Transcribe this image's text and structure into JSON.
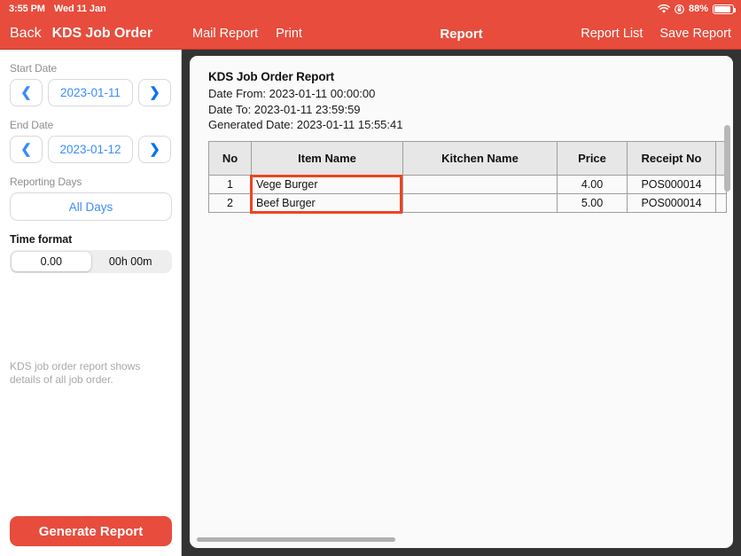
{
  "statusbar": {
    "time": "3:55 PM",
    "date": "Wed 11 Jan",
    "battery_percent": "88%",
    "wifi_icon": "wifi-icon",
    "rotation_lock_icon": "rotation-lock-icon",
    "battery_icon": "battery-icon"
  },
  "navbar": {
    "back_label": "Back",
    "screen_title": "KDS Job Order",
    "mail_report_label": "Mail Report",
    "print_label": "Print",
    "center_title": "Report",
    "report_list_label": "Report List",
    "save_report_label": "Save Report",
    "background_color": "#e74c3c"
  },
  "sidebar": {
    "start_date_label": "Start Date",
    "start_date_value": "2023-01-11",
    "end_date_label": "End Date",
    "end_date_value": "2023-01-12",
    "prev_icon": "chevron-left-icon",
    "next_icon": "chevron-right-icon",
    "reporting_days_label": "Reporting Days",
    "reporting_days_value": "All Days",
    "time_format_label": "Time format",
    "time_format_options": [
      "0.00",
      "00h 00m"
    ],
    "time_format_selected": "0.00",
    "hint_text": "KDS job order report shows details of all job order.",
    "generate_button_label": "Generate Report",
    "accent_color": "#3b8cfd"
  },
  "report": {
    "title": "KDS Job Order Report",
    "date_from": "Date From: 2023-01-11 00:00:00",
    "date_to": "Date To: 2023-01-11 23:59:59",
    "generated_date": "Generated Date: 2023-01-11 15:55:41",
    "columns": [
      "No",
      "Item Name",
      "Kitchen Name",
      "Price",
      "Receipt No"
    ],
    "rows": [
      {
        "no": "1",
        "item_name": "Vege Burger",
        "kitchen_name": "",
        "price": "4.00",
        "receipt_no": "POS000014"
      },
      {
        "no": "2",
        "item_name": "Beef Burger",
        "kitchen_name": "",
        "price": "5.00",
        "receipt_no": "POS000014"
      }
    ],
    "annotation_color": "#ee4422"
  }
}
